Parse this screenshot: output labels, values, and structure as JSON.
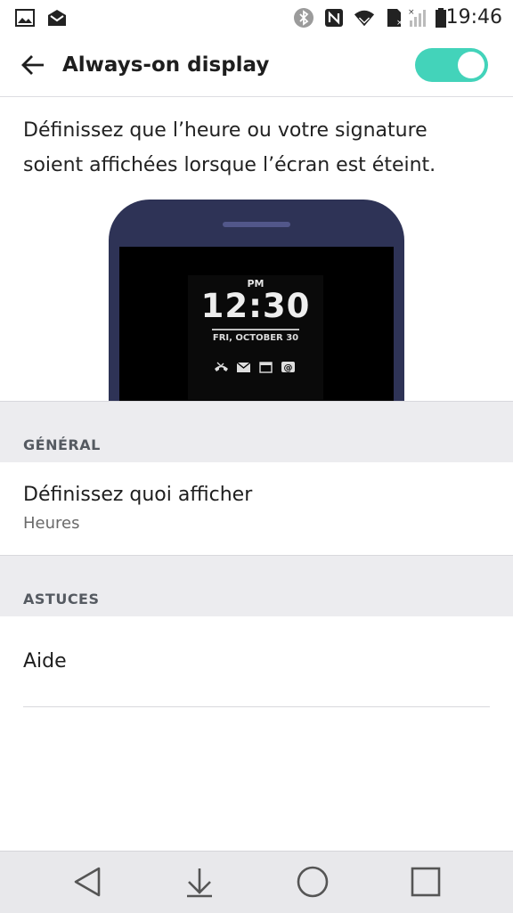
{
  "status_bar": {
    "time": "19:46",
    "icons": [
      "gallery-icon",
      "mail-icon",
      "bluetooth-icon",
      "nfc-icon",
      "wifi-icon",
      "sd-card-icon",
      "signal-icon",
      "battery-icon"
    ]
  },
  "header": {
    "title": "Always-on display",
    "toggle_state": "on",
    "accent_color": "#43d3ba"
  },
  "description": "Définissez que l’heure ou votre signature soient affichées lorsque l’écran est éteint.",
  "preview": {
    "ampm": "PM",
    "time": "12:30",
    "date": "FRI, OCTOBER 30",
    "notification_icons": [
      "missed-call-icon",
      "message-icon",
      "calendar-icon",
      "email-icon"
    ]
  },
  "sections": [
    {
      "header": "GÉNÉRAL",
      "items": [
        {
          "title": "Définissez quoi afficher",
          "subtitle": "Heures"
        }
      ]
    },
    {
      "header": "ASTUCES",
      "items": [
        {
          "title": "Aide"
        }
      ]
    }
  ],
  "nav_bar": {
    "buttons": [
      "back-icon",
      "notifications-pull-icon",
      "home-icon",
      "recents-icon"
    ]
  }
}
